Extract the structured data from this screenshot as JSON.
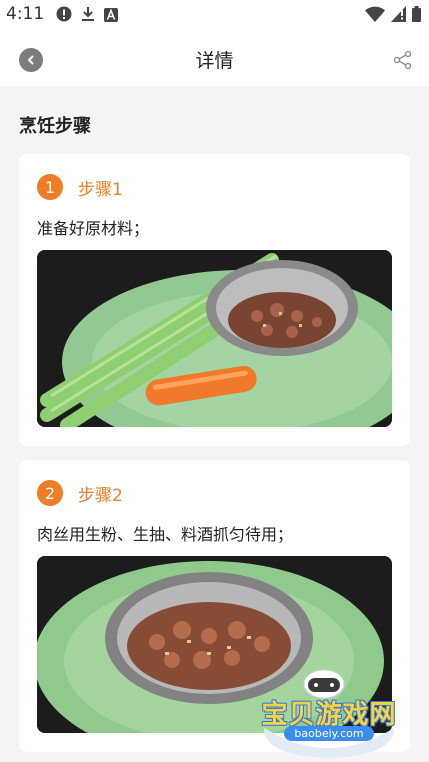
{
  "status_bar": {
    "time": "4:11",
    "left_icons": [
      "alert-icon",
      "download-icon",
      "font-icon"
    ],
    "right_icons": [
      "wifi-icon",
      "cellular-icon",
      "battery-icon"
    ]
  },
  "header": {
    "title": "详情",
    "back_icon": "chevron-left-icon",
    "share_icon": "share-icon"
  },
  "section": {
    "title": "烹饪步骤"
  },
  "steps": [
    {
      "number": "1",
      "label": "步骤1",
      "text": "准备好原材料；",
      "photo": "celery, carrot and meat in bowl on green plate"
    },
    {
      "number": "2",
      "label": "步骤2",
      "text": "肉丝用生粉、生抽、料酒抓匀待用；",
      "photo": "marinated shredded meat in bowl on green plate"
    }
  ],
  "watermark": {
    "text": "宝贝游戏网",
    "url": "baobeiy.com"
  },
  "colors": {
    "accent": "#ee7d25",
    "background": "#f4f4f4",
    "card": "#ffffff"
  }
}
